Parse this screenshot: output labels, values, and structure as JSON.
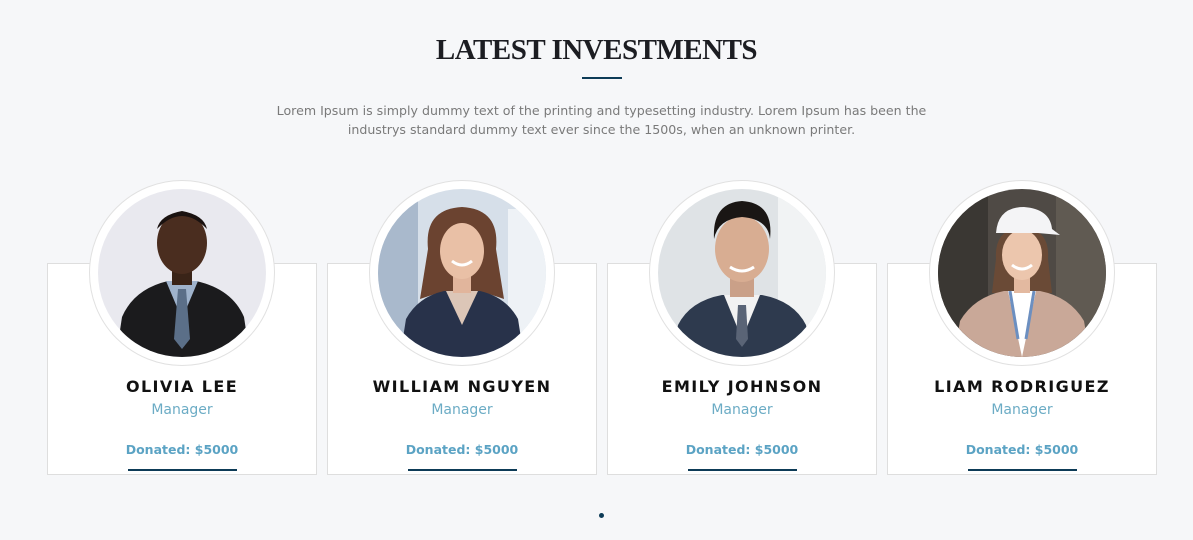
{
  "section": {
    "title": "LATEST INVESTMENTS",
    "intro": "Lorem Ipsum is simply dummy text of the printing and typesetting industry. Lorem Ipsum has been the industrys standard dummy text ever since the 1500s, when an unknown printer."
  },
  "investors": [
    {
      "name": "OLIVIA LEE",
      "role": "Manager",
      "donated": "Donated: $5000"
    },
    {
      "name": "WILLIAM NGUYEN",
      "role": "Manager",
      "donated": "Donated: $5000"
    },
    {
      "name": "EMILY JOHNSON",
      "role": "Manager",
      "donated": "Donated: $5000"
    },
    {
      "name": "LIAM RODRIGUEZ",
      "role": "Manager",
      "donated": "Donated: $5000"
    }
  ],
  "carousel": {
    "active_page": 1,
    "pages": 1
  },
  "colors": {
    "accent_dark": "#0d3b57",
    "accent_light": "#6cacc5",
    "background": "#f6f7f9"
  }
}
